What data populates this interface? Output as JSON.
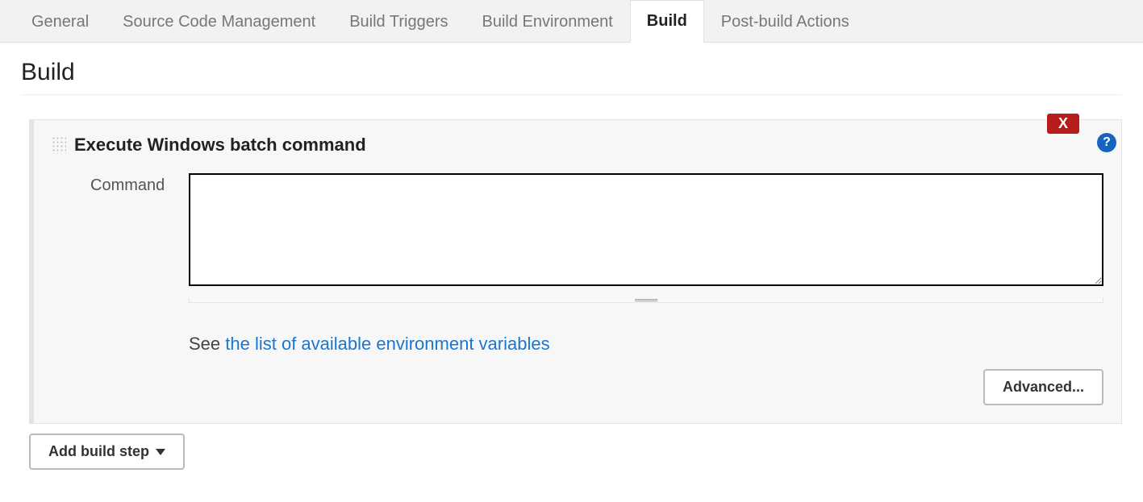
{
  "tabs": {
    "items": [
      {
        "label": "General"
      },
      {
        "label": "Source Code Management"
      },
      {
        "label": "Build Triggers"
      },
      {
        "label": "Build Environment"
      },
      {
        "label": "Build"
      },
      {
        "label": "Post-build Actions"
      }
    ],
    "active_index": 4
  },
  "section": {
    "title": "Build"
  },
  "step": {
    "title": "Execute Windows batch command",
    "delete_label": "X",
    "help_label": "?",
    "command_label": "Command",
    "command_value": "",
    "hint_prefix": "See ",
    "hint_link": "the list of available environment variables",
    "advanced_label": "Advanced..."
  },
  "add_step": {
    "label": "Add build step"
  }
}
